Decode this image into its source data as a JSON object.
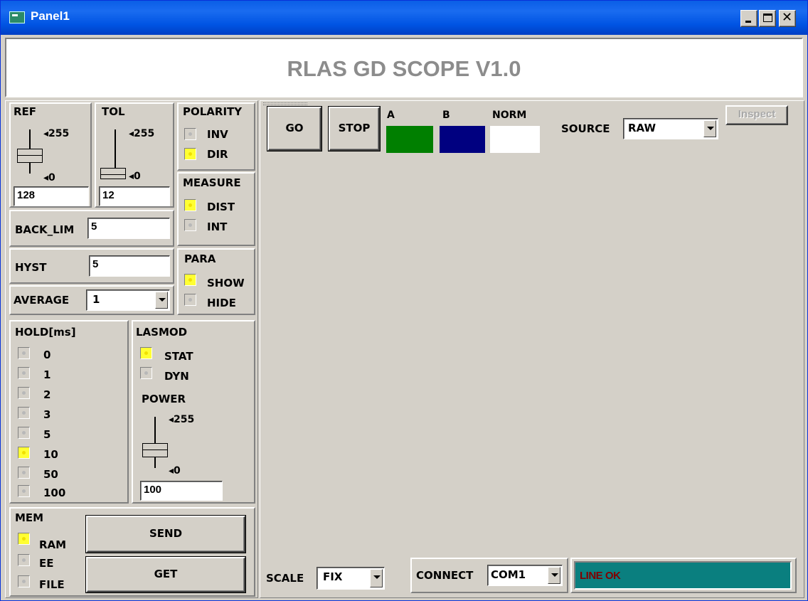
{
  "window": {
    "title": "Panel1"
  },
  "header": {
    "title": "RLAS GD SCOPE V1.0"
  },
  "ref": {
    "label": "REF",
    "max": "255",
    "min": "0",
    "value": "128"
  },
  "tol": {
    "label": "TOL",
    "max": "255",
    "min": "0",
    "value": "12"
  },
  "polarity": {
    "label": "POLARITY",
    "options": [
      {
        "label": "INV",
        "on": false
      },
      {
        "label": "DIR",
        "on": true
      }
    ]
  },
  "measure": {
    "label": "MEASURE",
    "options": [
      {
        "label": "DIST",
        "on": true
      },
      {
        "label": "INT",
        "on": false
      }
    ]
  },
  "back_lim": {
    "label": "BACK_LIM",
    "value": "5"
  },
  "hyst": {
    "label": "HYST",
    "value": "5"
  },
  "para": {
    "label": "PARA",
    "options": [
      {
        "label": "SHOW",
        "on": true
      },
      {
        "label": "HIDE",
        "on": false
      }
    ]
  },
  "average": {
    "label": "AVERAGE",
    "value": "1"
  },
  "hold": {
    "label": "HOLD[ms]",
    "options": [
      {
        "label": "0",
        "on": false
      },
      {
        "label": "1",
        "on": false
      },
      {
        "label": "2",
        "on": false
      },
      {
        "label": "3",
        "on": false
      },
      {
        "label": "5",
        "on": false
      },
      {
        "label": "10",
        "on": true
      },
      {
        "label": "50",
        "on": false
      },
      {
        "label": "100",
        "on": false
      }
    ]
  },
  "lasmod": {
    "label": "LASMOD",
    "options": [
      {
        "label": "STAT",
        "on": true
      },
      {
        "label": "DYN",
        "on": false
      }
    ],
    "power_label": "POWER",
    "power_max": "255",
    "power_min": "0",
    "power_value": "100"
  },
  "mem": {
    "label": "MEM",
    "options": [
      {
        "label": "RAM",
        "on": true
      },
      {
        "label": "EE",
        "on": false
      },
      {
        "label": "FILE",
        "on": false
      }
    ],
    "send_label": "SEND",
    "get_label": "GET"
  },
  "scope": {
    "go_label": "GO",
    "stop_label": "STOP",
    "legend": [
      {
        "label": "A",
        "color": "#007f00"
      },
      {
        "label": "B",
        "color": "#000080"
      },
      {
        "label": "NORM",
        "color": "#ffffff"
      }
    ],
    "source_label": "SOURCE",
    "source_value": "RAW",
    "inspect_label": "Inspect",
    "scale_label": "SCALE",
    "scale_value": "FIX",
    "connect_label": "CONNECT",
    "connect_value": "COM1",
    "status_text": "LINE OK",
    "status_bg": "#0a7f7f",
    "status_fg": "#800000"
  }
}
